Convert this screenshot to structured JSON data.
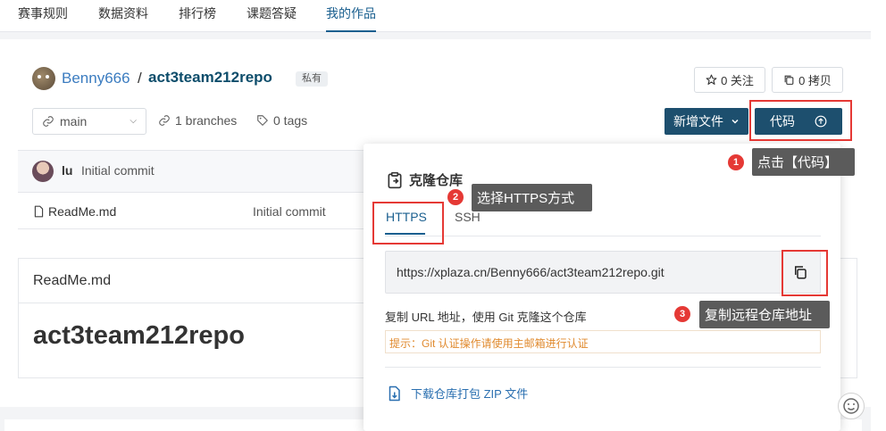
{
  "nav": {
    "tabs": [
      {
        "label": "赛事规则"
      },
      {
        "label": "数据资料"
      },
      {
        "label": "排行榜"
      },
      {
        "label": "课题答疑"
      },
      {
        "label": "我的作品",
        "active": true
      }
    ]
  },
  "repo": {
    "owner": "Benny666",
    "separator": "/",
    "name": "act3team212repo",
    "visibility": "私有",
    "watch_label": "0 关注",
    "fork_label": "0 拷贝"
  },
  "toolbar": {
    "branch": "main",
    "branches": "1 branches",
    "tags": "0 tags",
    "new_file": "新增文件",
    "code": "代码"
  },
  "commit": {
    "user": "lu",
    "message": "Initial commit"
  },
  "files": [
    {
      "name": "ReadMe.md",
      "commit": "Initial commit"
    }
  ],
  "readme": {
    "filename": "ReadMe.md",
    "heading": "act3team212repo"
  },
  "clone_popover": {
    "title": "克隆仓库",
    "tabs": [
      "HTTPS",
      "SSH"
    ],
    "url": "https://xplaza.cn/Benny666/act3team212repo.git",
    "hint": "复制 URL 地址，使用 Git 克隆这个仓库",
    "tip": "提示：Git 认证操作请使用主邮箱进行认证",
    "download": "下载仓库打包 ZIP 文件"
  },
  "annotations": [
    {
      "number": "1",
      "text": "点击【代码】"
    },
    {
      "number": "2",
      "text": "选择HTTPS方式"
    },
    {
      "number": "3",
      "text": "复制远程仓库地址"
    }
  ],
  "colors": {
    "accent": "#1d4f6e",
    "link": "#3b7cc0",
    "highlight": "#e53935",
    "tip": "#e08a2e"
  }
}
